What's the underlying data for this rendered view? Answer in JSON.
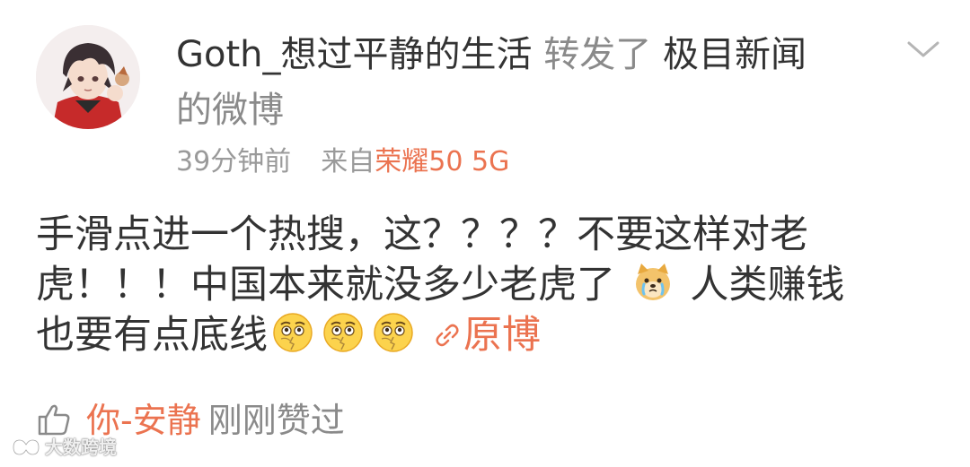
{
  "post": {
    "author": "Goth_想过平静的生活",
    "repost_word": "转发了",
    "source_prefix": "极目新闻",
    "source_suffix": "的微博",
    "time": "39分钟前",
    "from_label": "来自",
    "device": "荣耀50 5G",
    "content": {
      "line1": "手滑点进一个热搜，这？？？？不要这样对老",
      "line2_a": "虎！！！中国本来就没多少老虎了",
      "line2_b": "人类赚钱",
      "line3": "也要有点底线",
      "original_link": "原博"
    },
    "emojis": [
      "doge-crying-emoji",
      "sad-face-emoji",
      "sad-face-emoji",
      "sad-face-emoji"
    ]
  },
  "likes": {
    "liker": "你-安静",
    "text": "刚刚赞过"
  },
  "watermark": {
    "text": "大数跨境"
  },
  "colors": {
    "text": "#333333",
    "muted": "#8a8a8a",
    "link": "#eb7350"
  }
}
